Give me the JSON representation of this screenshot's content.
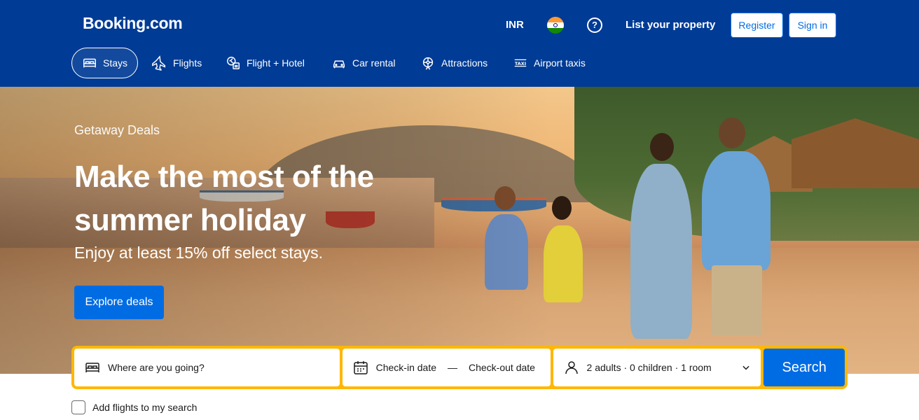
{
  "header": {
    "logo": "Booking.com",
    "currency": "INR",
    "list_property": "List your property",
    "register": "Register",
    "sign_in": "Sign in"
  },
  "nav": {
    "items": [
      {
        "label": "Stays",
        "icon": "bed-icon",
        "active": true
      },
      {
        "label": "Flights",
        "icon": "plane-icon",
        "active": false
      },
      {
        "label": "Flight + Hotel",
        "icon": "flight-hotel-icon",
        "active": false
      },
      {
        "label": "Car rental",
        "icon": "car-icon",
        "active": false
      },
      {
        "label": "Attractions",
        "icon": "attractions-icon",
        "active": false
      },
      {
        "label": "Airport taxis",
        "icon": "taxi-icon",
        "active": false
      }
    ]
  },
  "hero": {
    "eyebrow": "Getaway Deals",
    "headline": "Make the most of the summer holiday",
    "subline": "Enjoy at least 15% off select stays.",
    "cta": "Explore deals"
  },
  "search": {
    "destination_placeholder": "Where are you going?",
    "checkin": "Check-in date",
    "separator": "—",
    "checkout": "Check-out date",
    "guests": "2 adults · 0 children · 1 room",
    "search_button": "Search"
  },
  "add_flights_label": "Add flights to my search",
  "colors": {
    "brand_blue": "#003b95",
    "action_blue": "#006ce4",
    "search_border": "#ffb700"
  }
}
